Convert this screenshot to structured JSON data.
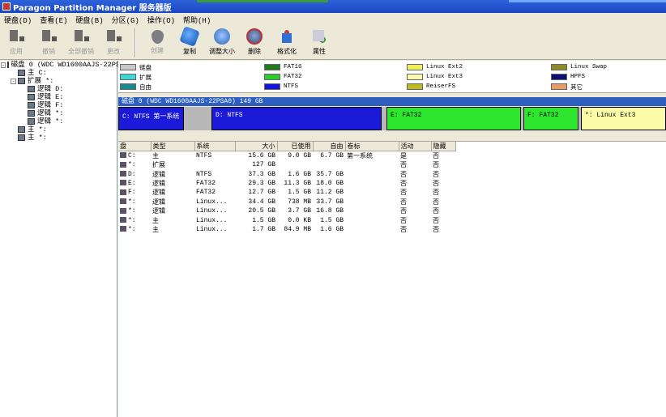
{
  "window": {
    "title": "Paragon Partition Manager 服务器版"
  },
  "menu": [
    "硬盘(D)",
    "查看(E)",
    "硬盘(B)",
    "分区(G)",
    "操作(O)",
    "帮助(H)"
  ],
  "toolbar": {
    "group1": [
      {
        "label": "应用",
        "icon": "apply-icon",
        "enabled": false
      },
      {
        "label": "撤销",
        "icon": "undo-icon",
        "enabled": false
      },
      {
        "label": "全部撤销",
        "icon": "undo-all-icon",
        "enabled": false
      },
      {
        "label": "更改",
        "icon": "changes-icon",
        "enabled": false
      }
    ],
    "group2": [
      {
        "label": "创建",
        "icon": "create-icon",
        "enabled": false
      },
      {
        "label": "复制",
        "icon": "copy-icon",
        "enabled": true
      },
      {
        "label": "调整大小",
        "icon": "resize-icon",
        "enabled": true
      },
      {
        "label": "删除",
        "icon": "delete-icon",
        "enabled": true
      },
      {
        "label": "格式化",
        "icon": "format-icon",
        "enabled": true
      },
      {
        "label": "属性",
        "icon": "properties-icon",
        "enabled": true
      }
    ]
  },
  "tree": [
    {
      "label": "磁盘 0 (WDC WD1600AAJS-22PS",
      "indent": 0,
      "expander": "-"
    },
    {
      "label": "主 C:",
      "indent": 1,
      "expander": ""
    },
    {
      "label": "扩展 *:",
      "indent": 1,
      "expander": "-"
    },
    {
      "label": "逻辑 D:",
      "indent": 2,
      "expander": ""
    },
    {
      "label": "逻辑 E:",
      "indent": 2,
      "expander": ""
    },
    {
      "label": "逻辑 F:",
      "indent": 2,
      "expander": ""
    },
    {
      "label": "逻辑 *:",
      "indent": 2,
      "expander": ""
    },
    {
      "label": "逻辑 *:",
      "indent": 2,
      "expander": ""
    },
    {
      "label": "主 *:",
      "indent": 1,
      "expander": ""
    },
    {
      "label": "主 *:",
      "indent": 1,
      "expander": ""
    }
  ],
  "legend": [
    {
      "label": "链盘",
      "color": "#c8c8c8",
      "col": 0,
      "row": 0
    },
    {
      "label": "扩展",
      "color": "#3fd6d6",
      "col": 0,
      "row": 1
    },
    {
      "label": "自由",
      "color": "#1a8a8a",
      "col": 0,
      "row": 2
    },
    {
      "label": "FAT16",
      "color": "#1f7a1f",
      "col": 1,
      "row": 0
    },
    {
      "label": "FAT32",
      "color": "#2ecb2e",
      "col": 1,
      "row": 1
    },
    {
      "label": "NTFS",
      "color": "#1313d8",
      "col": 1,
      "row": 2
    },
    {
      "label": "Linux Ext2",
      "color": "#f2ef5a",
      "col": 2,
      "row": 0
    },
    {
      "label": "Linux Ext3",
      "color": "#fbfbb0",
      "col": 2,
      "row": 1
    },
    {
      "label": "ReiserFS",
      "color": "#bdbb22",
      "col": 2,
      "row": 2
    },
    {
      "label": "Linux Swap",
      "color": "#8f8a2a",
      "col": 3,
      "row": 0
    },
    {
      "label": "HPFS",
      "color": "#101070",
      "col": 3,
      "row": 1
    },
    {
      "label": "其它",
      "color": "#e89a68",
      "col": 3,
      "row": 2
    }
  ],
  "diskmap": {
    "header": "磁盘 0 (WDC WD1600AAJS-22PSA0) 149 GB",
    "segments": [
      {
        "label": "C: NTFS 第一系统",
        "color": "#1a1ad8",
        "text_color": "#fff",
        "start": 0,
        "width": 0.12
      },
      {
        "label": "D: NTFS",
        "color": "#1a1ad8",
        "text_color": "#fff",
        "start": 0.17,
        "width": 0.31
      },
      {
        "label": "E: FAT32",
        "color": "#2ee62e",
        "text_color": "#000",
        "start": 0.49,
        "width": 0.245
      },
      {
        "label": "F: FAT32",
        "color": "#2ee62e",
        "text_color": "#000",
        "start": 0.74,
        "width": 0.1
      },
      {
        "label": "*: Linux Ext3",
        "color": "#fbfba8",
        "text_color": "#000",
        "start": 0.845,
        "width": 0.155
      }
    ]
  },
  "table": {
    "headers": [
      "盘",
      "类型",
      "系统",
      "大小",
      "已使用",
      "自由",
      "卷标",
      "活动",
      "隐藏"
    ],
    "rows": [
      [
        "C:",
        "主",
        "NTFS",
        "15.6 GB",
        "9.0 GB",
        "6.7 GB",
        "第一系统",
        "是",
        "否"
      ],
      [
        "*:",
        "扩展",
        "",
        "127 GB",
        "",
        "",
        "",
        "否",
        "否"
      ],
      [
        "D:",
        "逻辑",
        "NTFS",
        "37.3 GB",
        "1.6 GB",
        "35.7 GB",
        "",
        "否",
        "否"
      ],
      [
        "E:",
        "逻辑",
        "FAT32",
        "29.3 GB",
        "11.3 GB",
        "18.0 GB",
        "",
        "否",
        "否"
      ],
      [
        "F:",
        "逻辑",
        "FAT32",
        "12.7 GB",
        "1.5 GB",
        "11.2 GB",
        "",
        "否",
        "否"
      ],
      [
        "*:",
        "逻辑",
        "Linux...",
        "34.4 GB",
        "738 MB",
        "33.7 GB",
        "",
        "否",
        "否"
      ],
      [
        "*:",
        "逻辑",
        "Linux...",
        "20.5 GB",
        "3.7 GB",
        "16.8 GB",
        "",
        "否",
        "否"
      ],
      [
        "*:",
        "主",
        "Linux...",
        "1.5 GB",
        "0.0 KB",
        "1.5 GB",
        "",
        "否",
        "否"
      ],
      [
        "*:",
        "主",
        "Linux...",
        "1.7 GB",
        "84.9 MB",
        "1.6 GB",
        "",
        "否",
        "否"
      ]
    ]
  }
}
